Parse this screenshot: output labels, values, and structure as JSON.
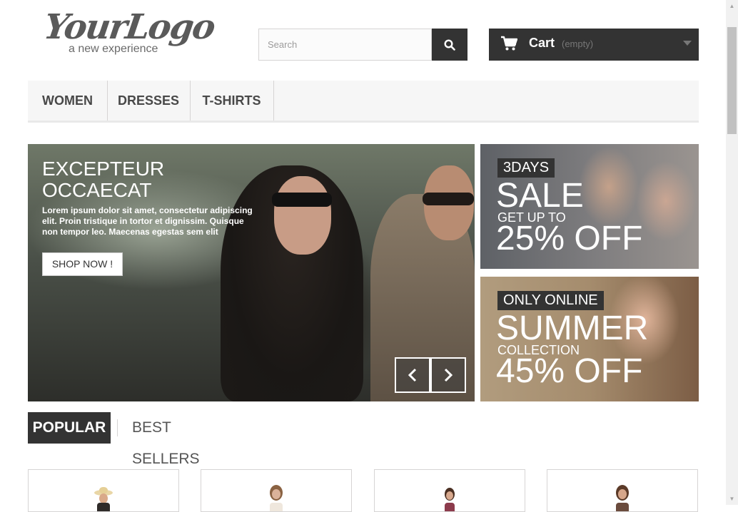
{
  "header": {
    "logo": {
      "script": "YourLogo",
      "tagline": "a new experience"
    },
    "search": {
      "placeholder": "Search"
    },
    "cart": {
      "label": "Cart",
      "quantity": "(empty)"
    }
  },
  "nav": {
    "items": [
      "WOMEN",
      "DRESSES",
      "T-SHIRTS"
    ]
  },
  "hero": {
    "title_line1": "EXCEPTEUR",
    "title_line2": "OCCAECAT",
    "description": "Lorem ipsum dolor sit amet, consectetur adipiscing elit. Proin tristique in tortor et dignissim. Quisque non tempor leo. Maecenas egestas sem elit",
    "button": "SHOP NOW !"
  },
  "banners": [
    {
      "tag": "3DAYS",
      "big": "SALE",
      "mid": "GET UP TO",
      "discount": "25% OFF"
    },
    {
      "tag": "ONLY ONLINE",
      "big": "SUMMER",
      "mid": "COLLECTION",
      "discount": "45% OFF"
    }
  ],
  "tabs": {
    "active": "POPULAR",
    "inactive": "BEST SELLERS"
  },
  "colors": {
    "dark": "#333333",
    "nav_bg": "#f6f6f6",
    "border": "#d6d4d4"
  },
  "products": [
    {
      "icon": "product-thumbnail-hat"
    },
    {
      "icon": "product-thumbnail-blouse"
    },
    {
      "icon": "product-thumbnail-dress"
    },
    {
      "icon": "product-thumbnail-top"
    }
  ]
}
